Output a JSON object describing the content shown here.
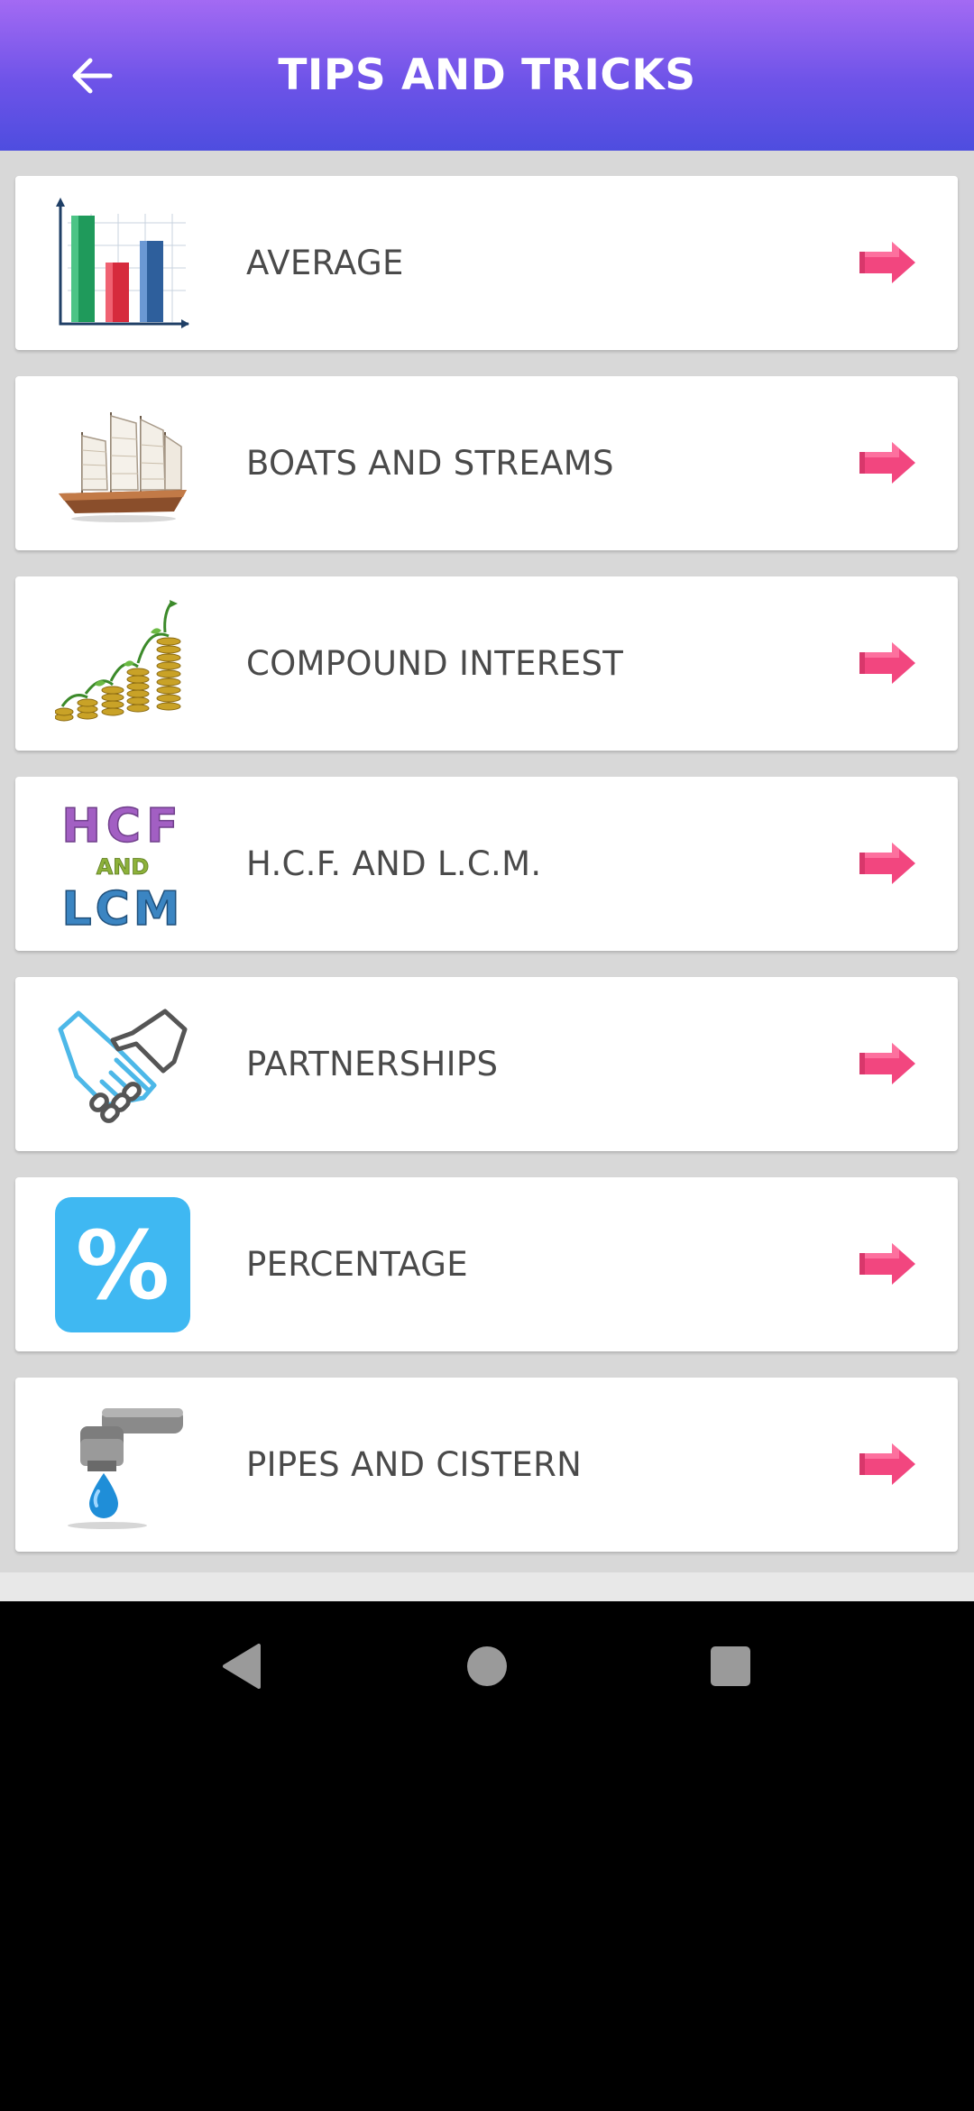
{
  "header": {
    "title": "TIPS AND TRICKS",
    "back_icon": "arrow-left-icon"
  },
  "topics": [
    {
      "label": "AVERAGE",
      "icon": "bar-chart-icon"
    },
    {
      "label": "BOATS AND STREAMS",
      "icon": "sailboat-icon"
    },
    {
      "label": "COMPOUND INTEREST",
      "icon": "coin-stacks-icon"
    },
    {
      "label": "H.C.F. AND L.C.M.",
      "icon": "hcf-lcm-icon",
      "icon_text": {
        "line1": "HCF",
        "line2": "AND",
        "line3": "LCM"
      }
    },
    {
      "label": "PARTNERSHIPS",
      "icon": "handshake-icon"
    },
    {
      "label": "PERCENTAGE",
      "icon": "percent-icon",
      "icon_text": "%"
    },
    {
      "label": "PIPES AND CISTERN",
      "icon": "water-tap-icon"
    }
  ],
  "colors": {
    "header_gradient_top": "#a36af3",
    "header_gradient_bottom": "#4e4ddf",
    "arrow": "#f2467f",
    "label": "#4a4a4a",
    "background": "#d8d8d8"
  },
  "nav": {
    "back": "nav-back-icon",
    "home": "nav-home-icon",
    "recents": "nav-recents-icon"
  }
}
